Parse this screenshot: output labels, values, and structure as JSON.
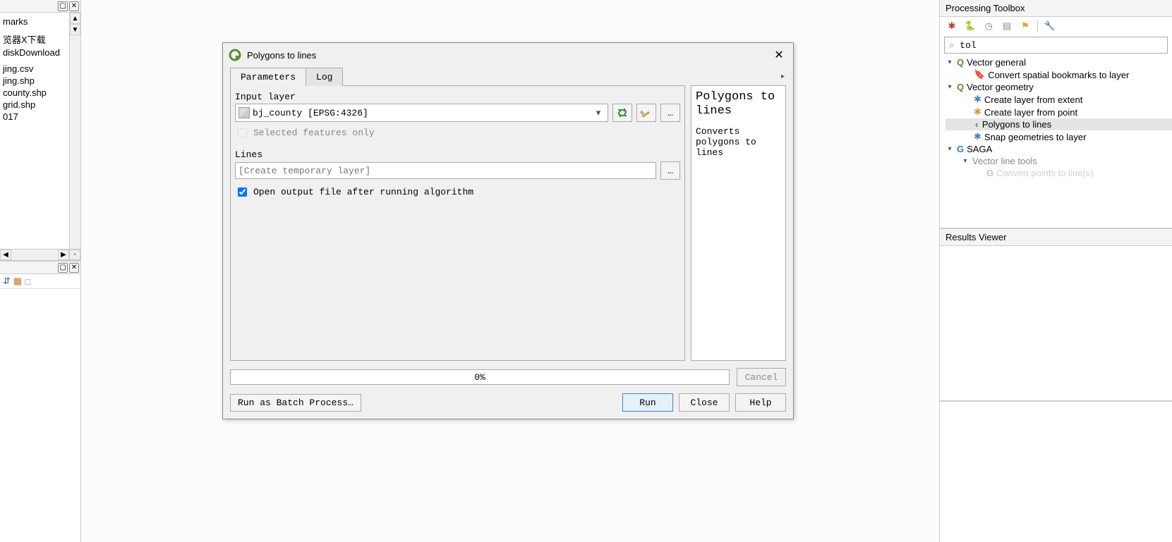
{
  "left_panel": {
    "tree_items": [
      "marks",
      "",
      "",
      "",
      "览器X下载",
      "diskDownload",
      "",
      "",
      "",
      "jing.csv",
      "jing.shp",
      "county.shp",
      "grid.shp",
      "017"
    ]
  },
  "dialog": {
    "title": "Polygons to lines",
    "tabs": {
      "parameters": "Parameters",
      "log": "Log"
    },
    "input_label": "Input layer",
    "input_value": "bj_county [EPSG:4326]",
    "selected_only": "Selected features only",
    "lines_label": "Lines",
    "lines_placeholder": "[Create temporary layer]",
    "open_after": "Open output file after running algorithm",
    "open_after_checked": true,
    "help": {
      "heading": "Polygons to lines",
      "desc": "Converts polygons to lines"
    },
    "progress": "0%",
    "buttons": {
      "cancel": "Cancel",
      "batch": "Run as Batch Process…",
      "run": "Run",
      "close": "Close",
      "help": "Help"
    }
  },
  "toolbox": {
    "title": "Processing Toolbox",
    "search_value": "tol",
    "tree": {
      "vector_general": "Vector general",
      "convert_bookmarks": "Convert spatial bookmarks to layer",
      "vector_geometry": "Vector geometry",
      "create_layer_extent": "Create layer from extent",
      "create_layer_point": "Create layer from point",
      "polygons_to_lines": "Polygons to lines",
      "snap_geometries": "Snap geometries to layer",
      "saga": "SAGA",
      "vector_line_tools": "Vector line tools",
      "convert_points_lines": "Convert points to line(s)"
    }
  },
  "results": {
    "title": "Results Viewer"
  }
}
